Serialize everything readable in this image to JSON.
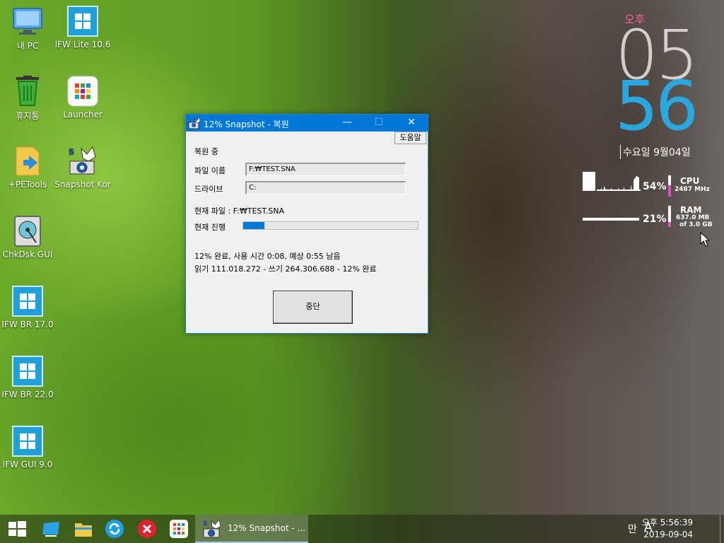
{
  "desktop": {
    "icons": [
      {
        "label": "내 PC"
      },
      {
        "label": "IFW Lite 10.6"
      },
      {
        "label": "휴지통"
      },
      {
        "label": "Launcher"
      },
      {
        "label": "+PETools"
      },
      {
        "label": "Snapshot Kor"
      },
      {
        "label": "ChkDsk GUI"
      },
      {
        "label": "IFW BR 17.0"
      },
      {
        "label": "IFW BR 22.0"
      },
      {
        "label": "IFW GUI 9.0"
      }
    ]
  },
  "dialog": {
    "title": "12% Snapshot - 복원",
    "help_label": "도움말",
    "status_heading": "복원 중",
    "file_name_label": "파일 이름",
    "file_name_value": "F:₩TEST.SNA",
    "drive_label": "드라이브",
    "drive_value": "C:",
    "current_file": "현재 파일 : F:₩TEST.SNA",
    "progress_label": "현재 진행",
    "progress_percent": 12,
    "summary_line1": "12% 완료,  사용 시간  0:08,  예상 0:55 남음",
    "summary_line2": "읽기  111.018.272 - 쓰기  264.306.688 - 12% 완료",
    "stop_label": "중단",
    "minimize_glyph": "—",
    "maximize_glyph": "☐",
    "close_glyph": "✕"
  },
  "clock_widget": {
    "ampm": "오후",
    "hour": "05",
    "minute": "56",
    "date": "수요일 9월04일"
  },
  "system_meter": {
    "cpu_percent": "54%",
    "cpu_label": "CPU",
    "cpu_freq": "2487 MHz",
    "ram_percent": "21%",
    "ram_label": "RAM",
    "ram_used": "637.0 MB",
    "ram_total": "of  3.0 GB"
  },
  "taskbar": {
    "active_task": "12% Snapshot - ...",
    "ime_mode": "만",
    "ime_lang": "A",
    "time": "오후 5:56:39",
    "date": "2019-09-04"
  },
  "colors": {
    "accent": "#0078d7",
    "clock_minute": "#27a8e0",
    "clock_ampm": "#ff5aa0",
    "meter_pink": "#e04ec8"
  }
}
